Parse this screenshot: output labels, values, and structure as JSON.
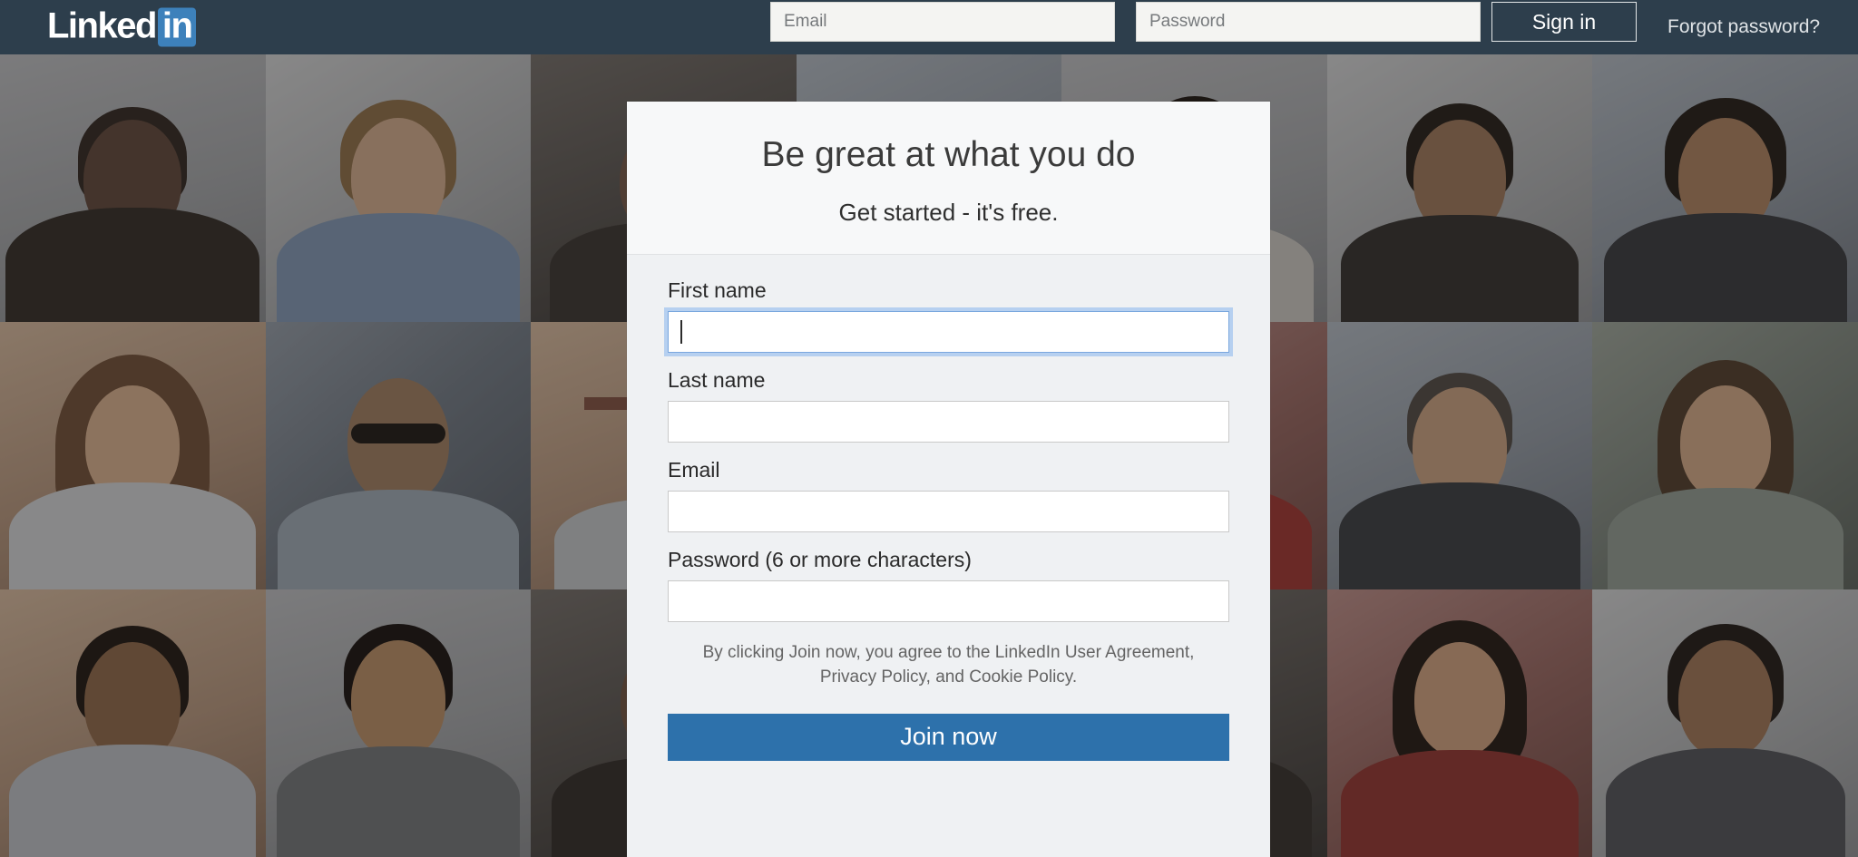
{
  "nav": {
    "logo_text": "Linked",
    "logo_badge": "in",
    "email_placeholder": "Email",
    "password_placeholder": "Password",
    "email_value": "",
    "password_value": "",
    "signin_label": "Sign in",
    "forgot_label": "Forgot password?"
  },
  "signup_card": {
    "title": "Be great at what you do",
    "subtitle": "Get started - it's free.",
    "fields": [
      {
        "label": "First name",
        "value": "",
        "focused": true
      },
      {
        "label": "Last name",
        "value": "",
        "focused": false
      },
      {
        "label": "Email",
        "value": "",
        "focused": false
      },
      {
        "label": "Password (6 or more characters)",
        "value": "",
        "focused": false
      }
    ],
    "legal_text": "By clicking Join now, you agree to the LinkedIn User Agreement, Privacy Policy, and Cookie Policy.",
    "join_label": "Join now"
  },
  "colors": {
    "nav_background": "#2d3e4c",
    "logo_badge_blue": "#3d81bb",
    "join_button_blue": "#2d71ab",
    "card_background": "#eff1f3",
    "card_header_background": "#f7f8f9",
    "focus_ring_blue": "#b6d0f0"
  },
  "background": {
    "description": "darkened grid of professional portrait photographs",
    "tiles": [
      {
        "name": "man-in-suit-smiling",
        "style": "p-room"
      },
      {
        "name": "woman-blonde-blue-jacket",
        "style": "p-office"
      },
      {
        "name": "man-partial-left",
        "style": "p-dark"
      },
      {
        "name": "man-dark-hair",
        "style": "p-cool"
      },
      {
        "name": "woman-dark-hair-white-top",
        "style": "p-room"
      },
      {
        "name": "man-smiling-suit",
        "style": "p-office"
      },
      {
        "name": "man-curly-hair-suit",
        "style": "p-cool"
      },
      {
        "name": "woman-long-hair-smiling",
        "style": "p-warm"
      },
      {
        "name": "man-sunglasses-city",
        "style": "p-street"
      },
      {
        "name": "indoor-scene-partial",
        "style": "p-warm"
      },
      {
        "name": "person-partial",
        "style": "p-dark"
      },
      {
        "name": "woman-red-top",
        "style": "p-red"
      },
      {
        "name": "man-grey-hair-suit",
        "style": "p-cool"
      },
      {
        "name": "woman-outdoor-park",
        "style": "p-park"
      },
      {
        "name": "man-smiling-striped-shirt",
        "style": "p-warm"
      },
      {
        "name": "man-short-hair-smiling",
        "style": "p-room"
      },
      {
        "name": "person-partial-lower",
        "style": "p-dark"
      },
      {
        "name": "person-partial-lower-2",
        "style": "p-cool"
      },
      {
        "name": "man-dark-lower",
        "style": "p-dark"
      },
      {
        "name": "woman-red-scarf",
        "style": "p-red"
      },
      {
        "name": "man-dark-hair-lower",
        "style": "p-office"
      }
    ]
  }
}
